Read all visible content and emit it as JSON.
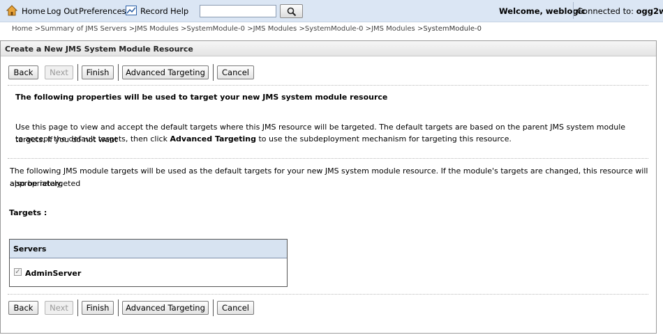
{
  "topnav": {
    "home": "Home",
    "logout": "Log Out",
    "preferences": "Preferences",
    "record": "Record",
    "help": "Help",
    "search_placeholder": "",
    "welcome": "Welcome, weblogic",
    "connected_label": "Connected to:",
    "connected_domain": "ogg2wls"
  },
  "breadcrumb": {
    "items": [
      "Home",
      "Summary of JMS Servers",
      "JMS Modules",
      "SystemModule-0",
      "JMS Modules",
      "SystemModule-0",
      "JMS Modules"
    ],
    "current": "SystemModule-0",
    "separator": ">"
  },
  "panel": {
    "title": "Create a New JMS System Module Resource"
  },
  "buttons": {
    "back": "Back",
    "next": "Next",
    "finish": "Finish",
    "advanced_targeting": "Advanced Targeting",
    "cancel": "Cancel"
  },
  "content": {
    "heading": "The following properties will be used to target your new JMS system module resource",
    "intro_1": "Use this page to view and accept the default targets where this JMS resource will be targeted. The default targets are based on the parent JMS system module targets. If you do not want",
    "intro_2_pre": "to accept the default targets, then click ",
    "intro_2_bold": "Advanced Targeting",
    "intro_2_post": " to use the subdeployment mechanism for targeting this resource.",
    "info_1": "The following JMS module targets will be used as the default targets for your new JMS system module resource. If the module's targets are changed, this resource will also be retargeted",
    "info_2": "appropriately.",
    "targets_label": "Targets :"
  },
  "servers_table": {
    "header": "Servers",
    "rows": [
      {
        "name": "AdminServer",
        "checked": true,
        "disabled": true
      }
    ]
  }
}
